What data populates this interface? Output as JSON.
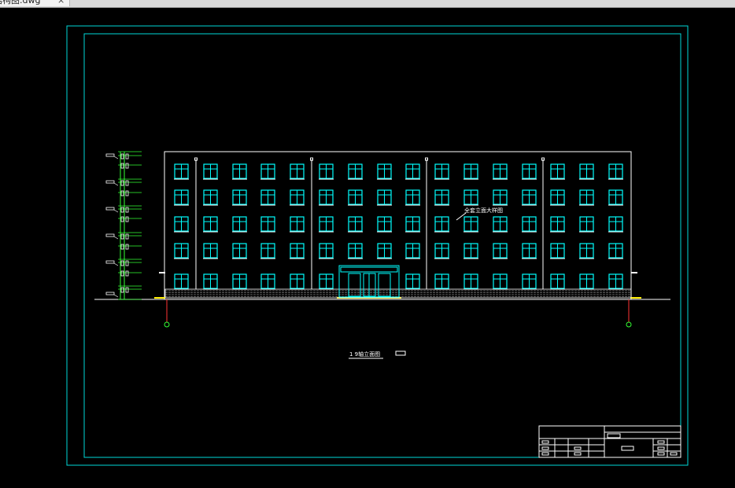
{
  "tab": {
    "title": "结构图.dwg",
    "close_glyph": "×"
  },
  "drawing": {
    "label_elevation_title": "1  9轴立面图",
    "label_wall_note": "全套立面大样图",
    "colors": {
      "background": "#000000",
      "frame": "#00d8d8",
      "building": "#ffffff",
      "window": "#00ffff",
      "dimension": "#33ff33",
      "axis": "#ff3333",
      "ground_accent": "#ffee00"
    },
    "window_grid": {
      "columns": 16,
      "floors": 5
    }
  }
}
